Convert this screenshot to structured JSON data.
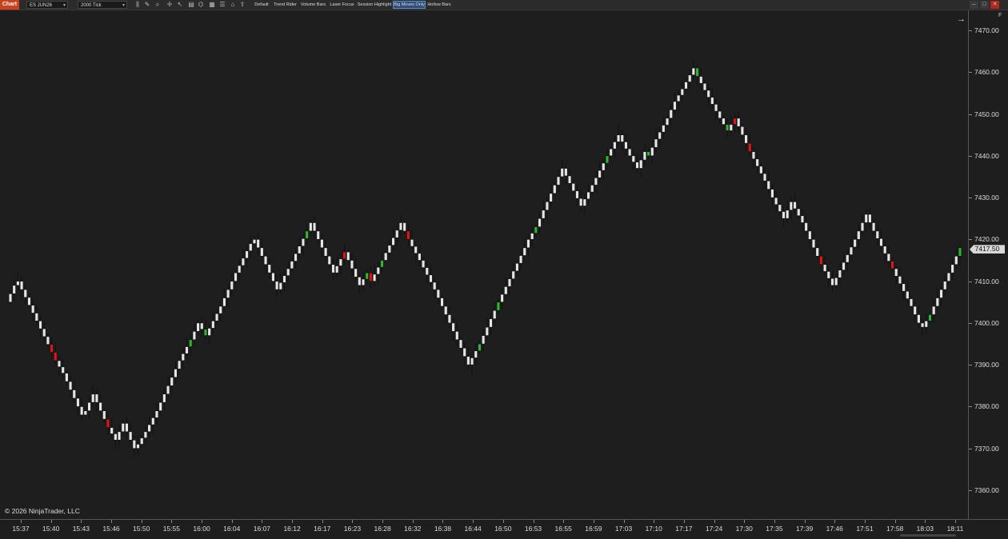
{
  "toolbar": {
    "tab_label": "Chart",
    "instrument": "ES JUN26",
    "interval": "2000 Tick",
    "buttons": [
      "Default",
      "Trend Rider",
      "Volume Bars",
      "Laser Focus",
      "Session Highlight",
      "Big Moves Only",
      "Hollow Bars"
    ],
    "active_button": "Big Moves Only"
  },
  "copyright": "© 2026 NinjaTrader, LLC",
  "axis_f_label": "F",
  "current_price": "7417.50",
  "colors": {
    "background": "#1e1e1e",
    "bar_neutral": "#e6e6e6",
    "bar_up_big": "#2db82d",
    "bar_down_big": "#e01515",
    "wick": "#111111",
    "tab_accent": "#c8431d"
  },
  "chart_data": {
    "type": "candlestick",
    "ylim": [
      7355,
      7475
    ],
    "price_ticks": [
      "7470.00",
      "7460.00",
      "7450.00",
      "7440.00",
      "7430.00",
      "7420.00",
      "7410.00",
      "7400.00",
      "7390.00",
      "7380.00",
      "7370.00",
      "7360.00"
    ],
    "time_labels": [
      "15:37",
      "15:40",
      "15:43",
      "15:46",
      "15:50",
      "15:55",
      "16:00",
      "16:04",
      "16:07",
      "16:12",
      "16:17",
      "16:23",
      "16:28",
      "16:32",
      "16:38",
      "16:44",
      "16:50",
      "16:53",
      "16:55",
      "16:59",
      "17:03",
      "17:10",
      "17:17",
      "17:24",
      "17:30",
      "17:35",
      "17:39",
      "17:46",
      "17:51",
      "17:58",
      "18:03",
      "18:11"
    ],
    "close_path": [
      7407,
      7409,
      7410,
      7408,
      7393,
      7391,
      7388,
      7382,
      7378,
      7379,
      7383,
      7375,
      7372,
      7376,
      7372,
      7370,
      7371,
      7374,
      7379,
      7385,
      7391,
      7396,
      7400,
      7397,
      7404,
      7412,
      7419,
      7420,
      7416,
      7408,
      7413,
      7422,
      7424,
      7412,
      7417,
      7409,
      7412,
      7410,
      7415,
      7424,
      7420,
      7415,
      7408,
      7400,
      7396,
      7392,
      7390,
      7395,
      7405,
      7418,
      7420,
      7423,
      7431,
      7437,
      7428,
      7433,
      7440,
      7445,
      7440,
      7437,
      7441,
      7440,
      7444,
      7449,
      7453,
      7456,
      7461,
      7459,
      7454,
      7449,
      7446,
      7449,
      7441,
      7434,
      7430,
      7425,
      7429,
      7424,
      7414,
      7409,
      7420,
      7426,
      7422,
      7413,
      7404,
      7400,
      7399,
      7402,
      7408,
      7412,
      7418
    ],
    "special_bars": [
      {
        "index": 4,
        "color": "red"
      },
      {
        "index": 5,
        "color": "red"
      },
      {
        "index": 11,
        "color": "red"
      },
      {
        "index": 21,
        "color": "green"
      },
      {
        "index": 23,
        "color": "green"
      },
      {
        "index": 31,
        "color": "green"
      },
      {
        "index": 34,
        "color": "red"
      },
      {
        "index": 36,
        "color": "green"
      },
      {
        "index": 37,
        "color": "red"
      },
      {
        "index": 38,
        "color": "green"
      },
      {
        "index": 40,
        "color": "red"
      },
      {
        "index": 47,
        "color": "green"
      },
      {
        "index": 48,
        "color": "green"
      },
      {
        "index": 51,
        "color": "green"
      },
      {
        "index": 56,
        "color": "green"
      },
      {
        "index": 61,
        "color": "green"
      },
      {
        "index": 67,
        "color": "green"
      },
      {
        "index": 70,
        "color": "green"
      },
      {
        "index": 71,
        "color": "red"
      },
      {
        "index": 72,
        "color": "red"
      },
      {
        "index": 78,
        "color": "red"
      },
      {
        "index": 83,
        "color": "red"
      },
      {
        "index": 87,
        "color": "green"
      },
      {
        "index": 90,
        "color": "green"
      }
    ]
  }
}
